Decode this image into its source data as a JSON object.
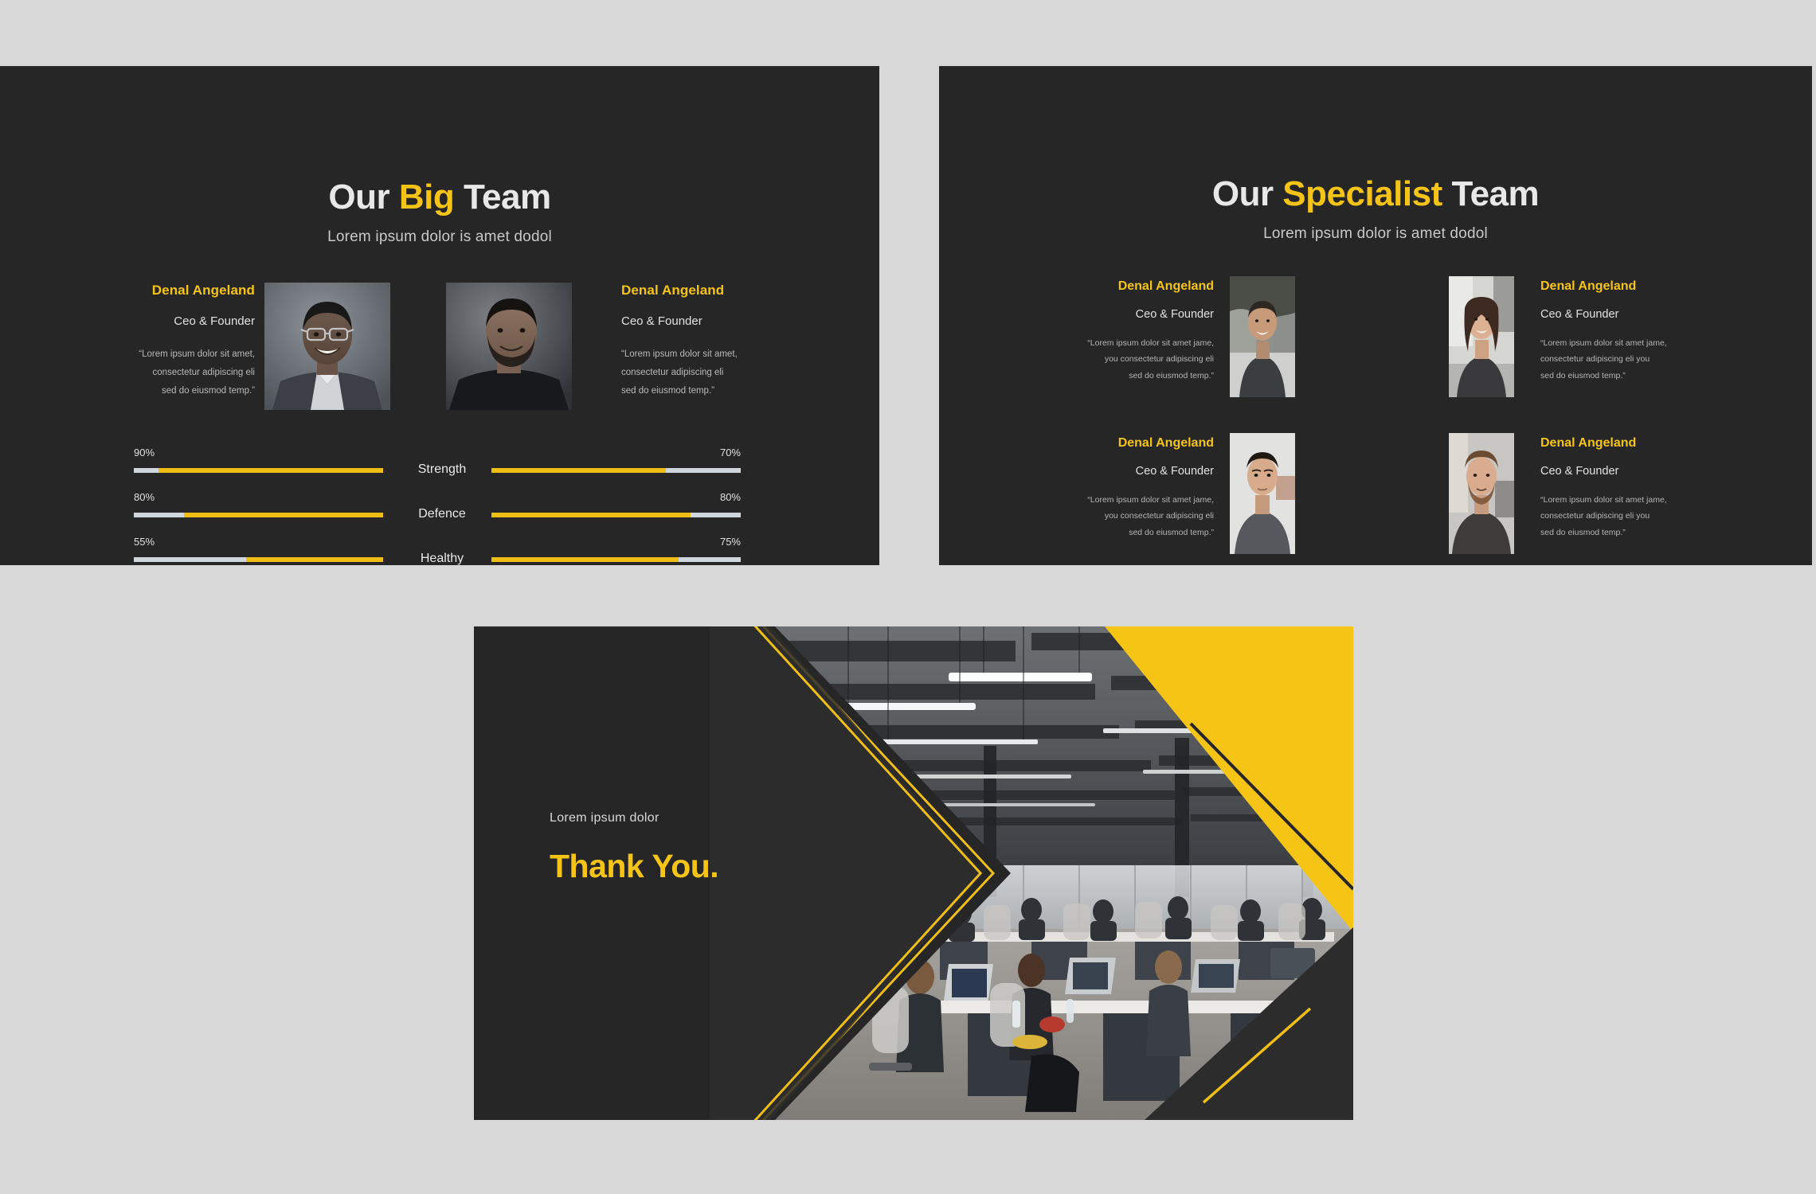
{
  "theme": {
    "page_background": "#d8d8d8",
    "slide_background": "#262626",
    "accent_yellow": "#f6c414",
    "track_grey": "#cfd6dd",
    "text_light": "#e8e8e8",
    "text_muted": "#b9b9b9"
  },
  "slide1": {
    "title_part1": "Our ",
    "title_accent": "Big",
    "title_part2": " Team",
    "subtitle": "Lorem ipsum dolor is amet dodol",
    "people": [
      {
        "name": "Denal Angeland",
        "role": "Ceo & Founder",
        "quote_line1": "“Lorem ipsum dolor sit amet,",
        "quote_line2": "consectetur adipiscing eli",
        "quote_line3": "sed do eiusmod temp.”",
        "photo_alt": "portrait-man-glasses"
      },
      {
        "name": "Denal Angeland",
        "role": "Ceo & Founder",
        "quote_line1": "“Lorem ipsum dolor sit amet,",
        "quote_line2": "consectetur adipiscing eli",
        "quote_line3": "sed do eiusmod temp.”",
        "photo_alt": "portrait-man-beard"
      }
    ],
    "skills": [
      {
        "label": "Strength",
        "left_pct_text": "90%",
        "left_value": 90,
        "right_pct_text": "70%",
        "right_value": 70
      },
      {
        "label": "Defence",
        "left_pct_text": "80%",
        "left_value": 80,
        "right_pct_text": "80%",
        "right_value": 80
      },
      {
        "label": "Healthy",
        "left_pct_text": "55%",
        "left_value": 55,
        "right_pct_text": "75%",
        "right_value": 75
      }
    ]
  },
  "slide2": {
    "title_part1": "Our ",
    "title_accent": "Specialist",
    "title_part2": " Team",
    "subtitle": "Lorem ipsum dolor is amet dodol",
    "people": [
      {
        "name": "Denal Angeland",
        "role": "Ceo & Founder",
        "quote_line1": "“Lorem ipsum dolor sit amet jame,",
        "quote_line2": "you consectetur adipiscing eli",
        "quote_line3": "sed do eiusmod temp.”",
        "photo_alt": "portrait-smiling-man-polo"
      },
      {
        "name": "Denal Angeland",
        "role": "Ceo & Founder",
        "quote_line1": "“Lorem ipsum dolor sit amet jame,",
        "quote_line2": "consectetur adipiscing eli you",
        "quote_line3": "sed do eiusmod temp.”",
        "photo_alt": "portrait-woman-dark-hair"
      },
      {
        "name": "Denal Angeland",
        "role": "Ceo & Founder",
        "quote_line1": "“Lorem ipsum dolor sit amet jame,",
        "quote_line2": "you consectetur adipiscing eli",
        "quote_line3": "sed do eiusmod temp.”",
        "photo_alt": "portrait-man-short-hair"
      },
      {
        "name": "Denal Angeland",
        "role": "Ceo & Founder",
        "quote_line1": "“Lorem ipsum dolor sit amet jame,",
        "quote_line2": "consectetur adipiscing eli you",
        "quote_line3": "sed do eiusmod temp.”",
        "photo_alt": "portrait-man-beard-outdoor"
      }
    ]
  },
  "slide3": {
    "eyebrow": "Lorem ipsum dolor",
    "thanks": "Thank You.",
    "photo_alt": "open-plan-office-coworking-space"
  }
}
